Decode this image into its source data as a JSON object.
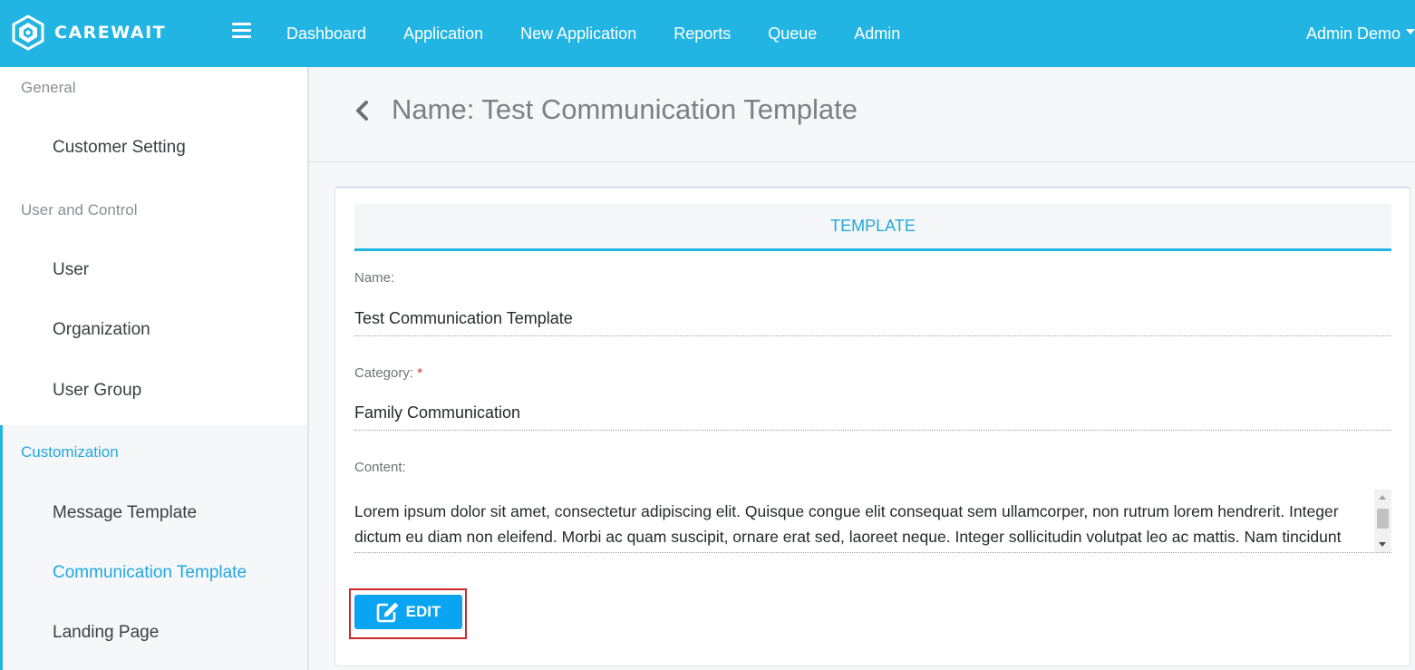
{
  "brand": {
    "name": "CAREWAIT",
    "logo_icon": "carewait-hexagon-logo-icon"
  },
  "topnav": {
    "menu_icon": "hamburger-menu-icon",
    "items": [
      {
        "label": "Dashboard"
      },
      {
        "label": "Application"
      },
      {
        "label": "New Application"
      },
      {
        "label": "Reports"
      },
      {
        "label": "Queue"
      },
      {
        "label": "Admin"
      }
    ],
    "user": {
      "label": "Admin Demo",
      "icon": "caret-down-icon"
    }
  },
  "sidebar": {
    "sections": [
      {
        "title": "General",
        "items": [
          {
            "label": "Customer Setting"
          }
        ]
      },
      {
        "title": "User and Control",
        "items": [
          {
            "label": "User"
          },
          {
            "label": "Organization"
          },
          {
            "label": "User Group"
          }
        ]
      },
      {
        "title": "Customization",
        "items": [
          {
            "label": "Message Template"
          },
          {
            "label": "Communication Template"
          },
          {
            "label": "Landing Page"
          }
        ]
      }
    ],
    "active_item": "Communication Template"
  },
  "header": {
    "back_icon": "chevron-left-icon",
    "title": "Name: Test Communication Template"
  },
  "card": {
    "tab_label": "TEMPLATE",
    "fields": {
      "name_label": "Name:",
      "name_value": "Test Communication Template",
      "category_label": "Category:",
      "category_required": "*",
      "category_value": "Family Communication",
      "content_label": "Content:",
      "content_value": "Lorem ipsum dolor sit amet, consectetur adipiscing elit. Quisque congue elit consequat sem ullamcorper, non rutrum lorem hendrerit. Integer dictum eu diam non eleifend. Morbi ac quam suscipit, ornare erat sed, laoreet neque. Integer sollicitudin volutpat leo ac mattis. Nam tincidunt"
    },
    "edit_button": {
      "label": "EDIT",
      "icon": "edit-pencil-square-icon"
    }
  },
  "colors": {
    "primary": "#22b4e3",
    "button": "#0aa5f2",
    "highlight": "#d0282a",
    "active_text": "#22a8dc"
  }
}
